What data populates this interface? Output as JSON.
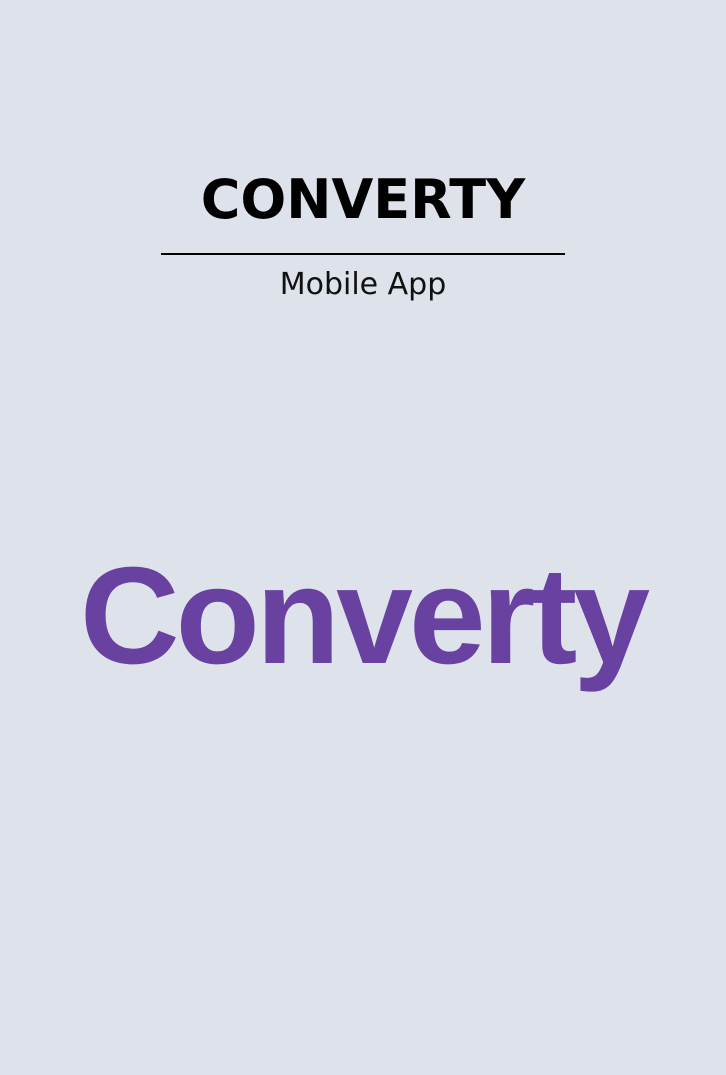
{
  "header": {
    "title": "CONVERTY",
    "subtitle": "Mobile App"
  },
  "logo": {
    "wordmark": "Converty",
    "color": "#6941a0"
  },
  "theme": {
    "background": "#dee2ea",
    "text": "#000000"
  }
}
